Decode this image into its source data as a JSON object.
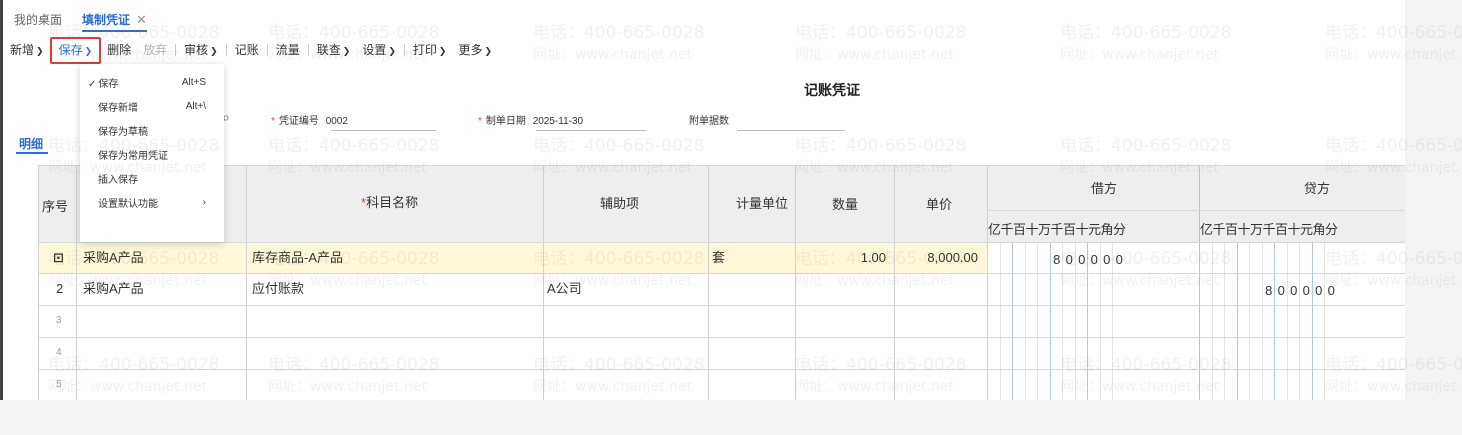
{
  "tabs": [
    {
      "label": "我的桌面",
      "active": false
    },
    {
      "label": "填制凭证",
      "active": true,
      "closable": true
    }
  ],
  "toolbar": {
    "items": [
      {
        "label": "新增",
        "caret": true,
        "disabled": false
      },
      {
        "label": "保存",
        "caret": true,
        "disabled": false,
        "highlighted": true
      },
      {
        "label": "删除",
        "caret": false,
        "disabled": false
      },
      {
        "label": "放弃",
        "caret": false,
        "disabled": true
      },
      {
        "label": "审核",
        "caret": true,
        "disabled": false
      },
      {
        "label": "记账",
        "caret": false,
        "disabled": false
      },
      {
        "label": "流量",
        "caret": false,
        "disabled": false
      },
      {
        "label": "联查",
        "caret": true,
        "disabled": false
      },
      {
        "label": "设置",
        "caret": true,
        "disabled": false
      },
      {
        "label": "打印",
        "caret": true,
        "disabled": false
      },
      {
        "label": "更多",
        "caret": true,
        "disabled": false
      }
    ]
  },
  "save_menu": [
    {
      "label": "保存",
      "shortcut": "Alt+S",
      "checked": true
    },
    {
      "label": "保存新增",
      "shortcut": "Alt+\\",
      "checked": false
    },
    {
      "label": "保存为草稿",
      "shortcut": "",
      "checked": false
    },
    {
      "label": "保存为常用凭证",
      "shortcut": "",
      "checked": false
    },
    {
      "label": "插入保存",
      "shortcut": "",
      "checked": false
    },
    {
      "label": "设置默认功能",
      "shortcut": "",
      "checked": false,
      "submenu": true
    }
  ],
  "voucher": {
    "title": "记账凭证",
    "number_label": "凭证编号",
    "number_value": "0002",
    "date_label": "制单日期",
    "date_value": "2025-11-30",
    "attach_label": "附单据数",
    "attach_value": ""
  },
  "subtab": "明细",
  "grid": {
    "headers": {
      "seq": "序号",
      "subject": "科目名称",
      "aux": "辅助项",
      "unit": "计量单位",
      "qty": "数量",
      "price": "单价",
      "debit": "借方",
      "credit": "贷方",
      "digit_units": [
        "亿",
        "千",
        "百",
        "十",
        "万",
        "千",
        "百",
        "十",
        "元",
        "角",
        "分"
      ]
    },
    "rows": [
      {
        "seq": "⊡",
        "summary": "采购A产品",
        "subject": "库存商品-A产品",
        "aux": "",
        "unit": "套",
        "qty": "1.00",
        "price": "8,000.00",
        "debit_digits": "800000",
        "credit_digits": ""
      },
      {
        "seq": "2",
        "summary": "采购A产品",
        "subject": "应付账款",
        "aux": "A公司",
        "unit": "",
        "qty": "",
        "price": "",
        "debit_digits": "",
        "credit_digits": "800000"
      },
      {
        "seq": "3",
        "summary": "",
        "subject": "",
        "aux": "",
        "unit": "",
        "qty": "",
        "price": "",
        "debit_digits": "",
        "credit_digits": ""
      },
      {
        "seq": "4",
        "summary": "",
        "subject": "",
        "aux": "",
        "unit": "",
        "qty": "",
        "price": "",
        "debit_digits": "",
        "credit_digits": ""
      },
      {
        "seq": "5",
        "summary": "",
        "subject": "",
        "aux": "",
        "unit": "",
        "qty": "",
        "price": "",
        "debit_digits": "",
        "credit_digits": ""
      }
    ]
  },
  "watermark": {
    "phone": "电话：400-665-0028",
    "site": "网址：www.chanjet.net"
  },
  "colors": {
    "accent": "#2d6fd9",
    "highlight_border": "#e53935",
    "active_row": "#fef8d8"
  }
}
